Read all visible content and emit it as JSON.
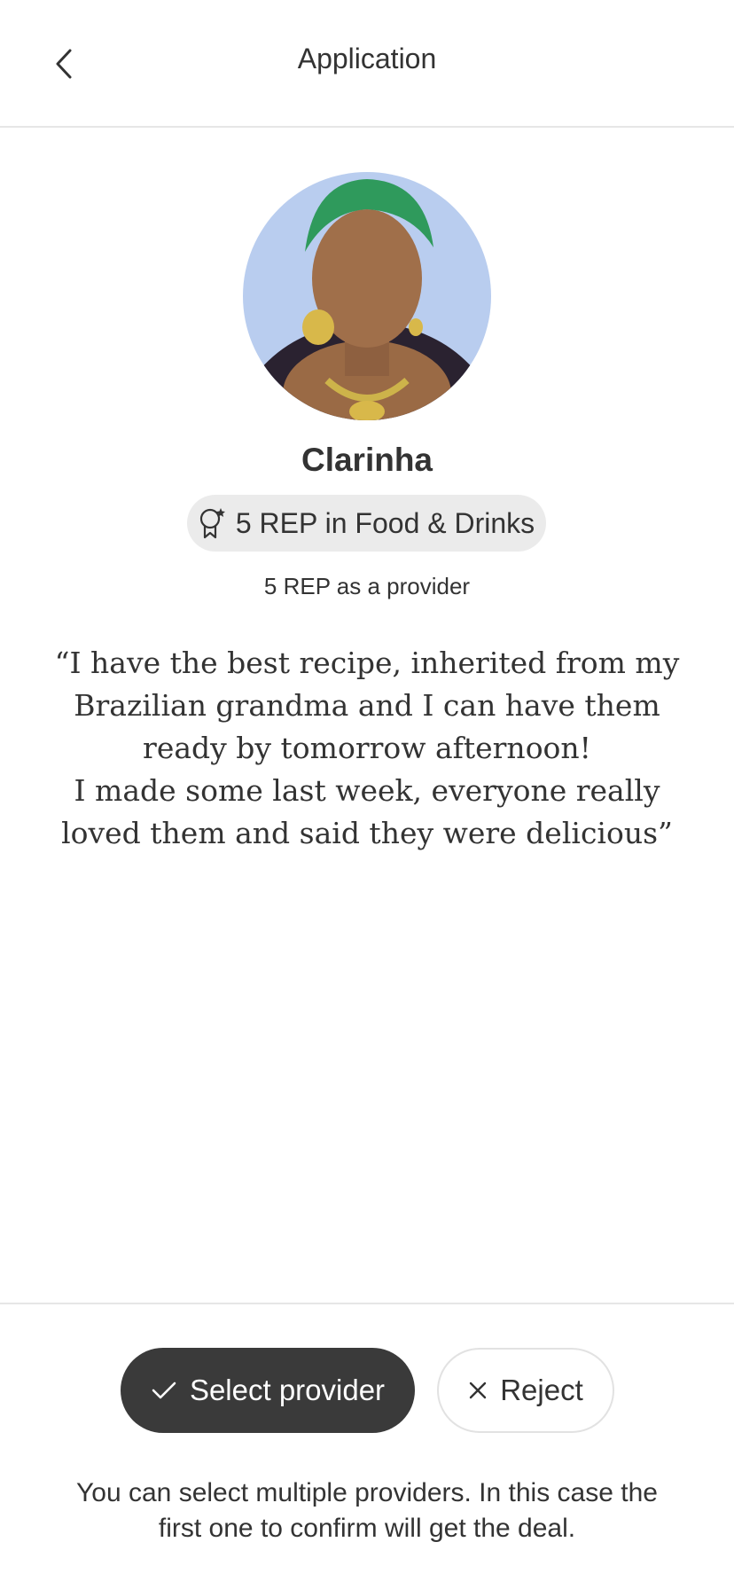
{
  "header": {
    "title": "Application",
    "back_icon": "chevron-left-icon"
  },
  "provider": {
    "name": "Clarinha",
    "rep_badge_icon": "award-star-icon",
    "rep_category": "5 REP in Food & Drinks",
    "rep_provider": "5 REP as a provider",
    "quote_lines": [
      "“I have the best recipe, inherited from my",
      "Brazilian grandma and I can have them",
      "ready by tomorrow afternoon!",
      "I made some last week, everyone really",
      "loved them and said they were delicious”"
    ]
  },
  "actions": {
    "select_label": "Select provider",
    "select_icon": "check-icon",
    "reject_label": "Reject",
    "reject_icon": "close-icon"
  },
  "footer": {
    "note_lines": [
      "You can select multiple providers. In this case the",
      "first one to confirm will get the deal."
    ]
  },
  "colors": {
    "primary_button": "#3a3a3a",
    "pill_background": "#ebebeb",
    "divider": "#e6e6e6"
  }
}
